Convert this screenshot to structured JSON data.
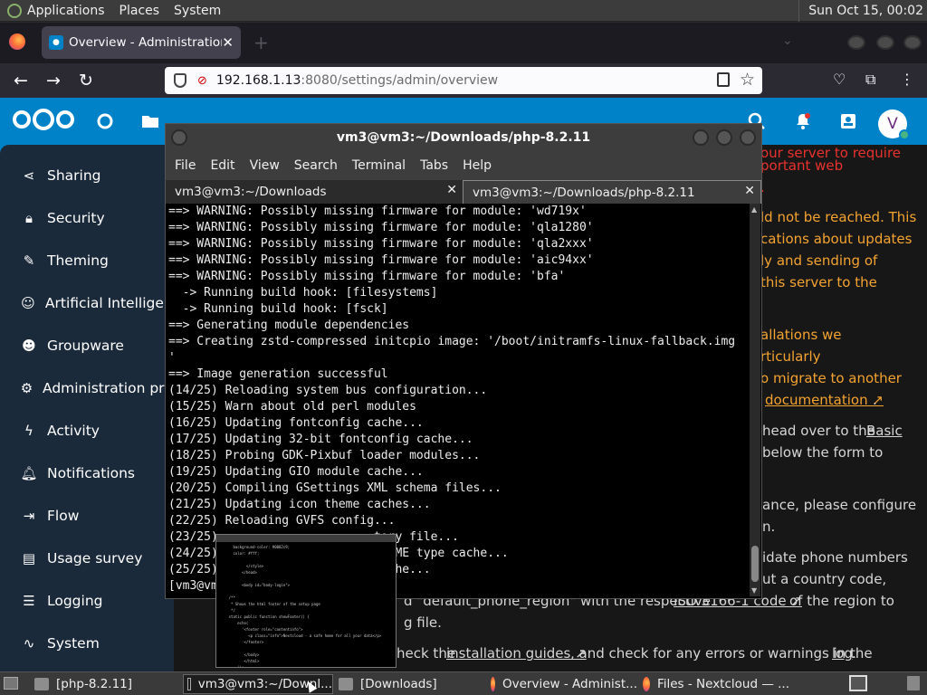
{
  "top_panel": {
    "menus": [
      "Applications",
      "Places",
      "System"
    ],
    "clock": "Sun Oct 15, 00:02"
  },
  "firefox": {
    "tab_title": "Overview - Administration s",
    "url_host": "192.168.1.13",
    "url_rest": ":8080/settings/admin/overview"
  },
  "nextcloud": {
    "avatar_letter": "V",
    "sidebar": [
      {
        "label": "Sharing",
        "icon": "share-icon",
        "glyph": "⋖"
      },
      {
        "label": "Security",
        "icon": "lock-icon",
        "glyph": "🔒︎"
      },
      {
        "label": "Theming",
        "icon": "brush-icon",
        "glyph": "✎"
      },
      {
        "label": "Artificial Intelligence",
        "icon": "robot-icon",
        "glyph": "☺"
      },
      {
        "label": "Groupware",
        "icon": "groupware-icon",
        "glyph": "☻"
      },
      {
        "label": "Administration privileges",
        "icon": "cog-icon",
        "glyph": "⚙"
      },
      {
        "label": "Activity",
        "icon": "activity-icon",
        "glyph": "ϟ"
      },
      {
        "label": "Notifications",
        "icon": "bell-icon",
        "glyph": "🔔︎"
      },
      {
        "label": "Flow",
        "icon": "flow-icon",
        "glyph": "⇥"
      },
      {
        "label": "Usage survey",
        "icon": "clipboard-icon",
        "glyph": "▤"
      },
      {
        "label": "Logging",
        "icon": "log-icon",
        "glyph": "☰"
      },
      {
        "label": "System",
        "icon": "pulse-icon",
        "glyph": "∿"
      }
    ],
    "content_fragments": {
      "red_1": "our server to require",
      "red_2": "portant web",
      "warn_1": "ld not be reached. This",
      "warn_2": "cations about updates",
      "warn_3": "ly and sending of",
      "warn_4": "this server to the",
      "warn_5": "allations we",
      "warn_6": "rticularly",
      "warn_7": "o migrate to another",
      "warn_8_link": "documentation ↗",
      "warn_8_tail": ".",
      "basic_1": "head over to the",
      "basic_link": "Basic",
      "basic_2": "below the form to",
      "perf_1": "ance, please configure",
      "perf_2": "n.",
      "phone_1": "idate phone numbers",
      "phone_2": "ut a country code,",
      "phone_3": "d \"default_phone_region\" with the respective",
      "phone_link": "ISO 3166-1 code ↗",
      "phone_4": "of the region to",
      "phone_5": "g file.",
      "guide_1": "heck the",
      "guide_link": "installation guides ↗",
      "guide_2": ", and check for any errors or warnings in the",
      "guide_log": "log",
      "guide_end": "."
    }
  },
  "terminal": {
    "title": "vm3@vm3:~/Downloads/php-8.2.11",
    "menus": [
      "File",
      "Edit",
      "View",
      "Search",
      "Terminal",
      "Tabs",
      "Help"
    ],
    "tabs": [
      "vm3@vm3:~/Downloads",
      "vm3@vm3:~/Downloads/php-8.2.11"
    ],
    "lines": [
      "==> WARNING: Possibly missing firmware for module: 'wd719x'",
      "==> WARNING: Possibly missing firmware for module: 'qla1280'",
      "==> WARNING: Possibly missing firmware for module: 'qla2xxx'",
      "==> WARNING: Possibly missing firmware for module: 'aic94xx'",
      "==> WARNING: Possibly missing firmware for module: 'bfa'",
      "  -> Running build hook: [filesystems]",
      "  -> Running build hook: [fsck]",
      "==> Generating module dependencies",
      "==> Creating zstd-compressed initcpio image: '/boot/initramfs-linux-fallback.img",
      "'",
      "==> Image generation successful",
      "(14/25) Reloading system bus configuration...",
      "(15/25) Warn about old perl modules",
      "(16/25) Updating fontconfig cache...",
      "(17/25) Updating 32-bit fontconfig cache...",
      "(18/25) Probing GDK-Pixbuf loader modules...",
      "(19/25) Updating GIO module cache...",
      "(20/25) Compiling GSettings XML schema files...",
      "(21/25) Updating icon theme caches...",
      "(22/25) Reloading GVFS config...",
      "(23/25)                      tory file...",
      "(24/25)                     e MIME type cache...",
      "(25/25)                      cache...",
      "[vm3@vm"
    ]
  },
  "taskbar": {
    "tasks": [
      "[php-8.2.11]",
      "vm3@vm3:~/Downl...",
      "[Downloads]",
      "Overview - Administ...",
      "Files - Nextcloud — ..."
    ]
  }
}
